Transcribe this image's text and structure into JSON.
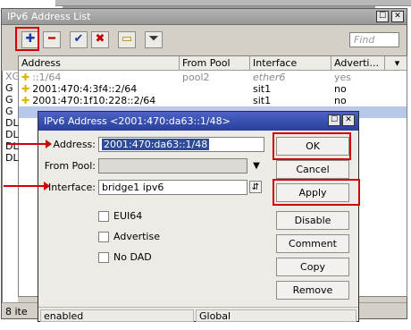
{
  "list_window": {
    "title": "IPv6 Address List",
    "find_placeholder": "Find",
    "columns": [
      "Address",
      "From Pool",
      "Interface",
      "Adverti..."
    ],
    "rows": [
      {
        "flag": "XG",
        "address": "::1/64",
        "pool": "pool2",
        "interface": "ether6",
        "advertise": "yes"
      },
      {
        "flag": "G",
        "address": "2001:470:4:3f4::2/64",
        "pool": "",
        "interface": "sit1",
        "advertise": "no"
      },
      {
        "flag": "G",
        "address": "2001:470:1f10:228::2/64",
        "pool": "",
        "interface": "sit1",
        "advertise": "no"
      }
    ],
    "extra_flags": [
      "G",
      "DL",
      "DL",
      "DL",
      "DL"
    ],
    "items_count": "8 ite"
  },
  "dialog": {
    "title": "IPv6 Address <2001:470:da63::1/48>",
    "address_label": "Address:",
    "address_value": "2001:470:da63::1/48",
    "from_pool_label": "From Pool:",
    "interface_label": "Interface:",
    "interface_value": "bridge1 ipv6",
    "checkboxes": [
      "EUI64",
      "Advertise",
      "No DAD"
    ],
    "buttons": [
      "OK",
      "Cancel",
      "Apply",
      "Disable",
      "Comment",
      "Copy",
      "Remove"
    ],
    "status": [
      "enabled",
      "Global"
    ]
  },
  "colors": {
    "highlight": "#d20000",
    "dialog_title": "#2a3f9c"
  }
}
